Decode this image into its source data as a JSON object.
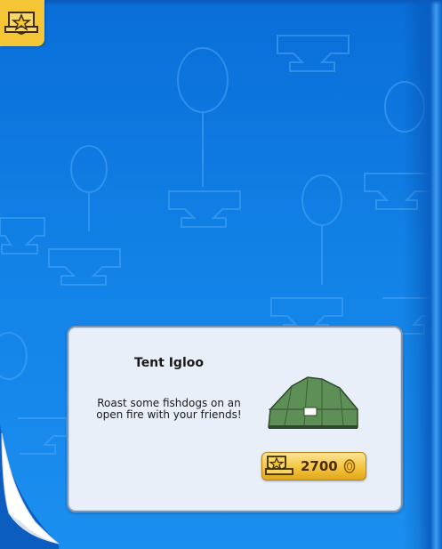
{
  "catalog_page": {
    "background_color": "#1181e6",
    "badge_color": "#f4c534",
    "item": {
      "title": "Tent Igloo",
      "description_line1": "Roast some fishdogs on an",
      "description_line2": "open fire with your friends!",
      "image_icon": "tent-igloo",
      "price": "2700",
      "price_icon": "coin-icon",
      "member_icon": "member-star-icon"
    }
  }
}
